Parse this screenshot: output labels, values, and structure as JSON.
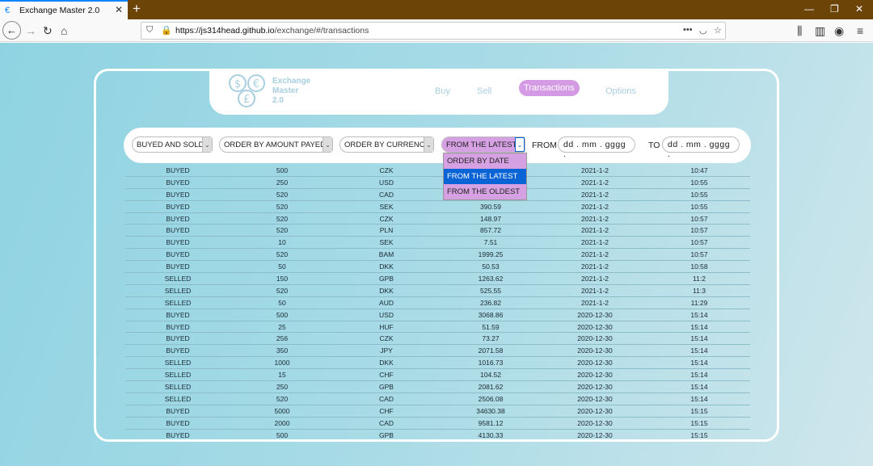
{
  "browser": {
    "tab_title": "Exchange Master 2.0",
    "url_host": "https://js314head.github.io",
    "url_path": "/exchange/#/transactions"
  },
  "header": {
    "brand": [
      "Exchange",
      "Master",
      "2.0"
    ],
    "nav": [
      {
        "label": "Buy"
      },
      {
        "label": "Sell"
      },
      {
        "label": "Transactions"
      },
      {
        "label": "Options"
      }
    ]
  },
  "filters": {
    "type": "BUYED AND SOLD",
    "amount": "ORDER BY AMOUNT PAYED",
    "currency": "ORDER BY CURRENCY",
    "date": "FROM THE LATEST",
    "from_label": "FROM",
    "to_label": "TO",
    "from_placeholder": "dd . mm . gggg .",
    "to_placeholder": "dd . mm . gggg ."
  },
  "dropdown_options": [
    "ORDER BY DATE",
    "FROM THE LATEST",
    "FROM THE OLDEST"
  ],
  "transactions": [
    [
      "BUYED",
      "500",
      "CZK",
      "",
      "2021-1-2",
      "10:47"
    ],
    [
      "BUYED",
      "250",
      "USD",
      "",
      "2021-1-2",
      "10:55"
    ],
    [
      "BUYED",
      "520",
      "CAD",
      "",
      "2021-1-2",
      "10:55"
    ],
    [
      "BUYED",
      "520",
      "SEK",
      "390.59",
      "2021-1-2",
      "10:55"
    ],
    [
      "BUYED",
      "520",
      "CZK",
      "148.97",
      "2021-1-2",
      "10:57"
    ],
    [
      "BUYED",
      "520",
      "PLN",
      "857.72",
      "2021-1-2",
      "10:57"
    ],
    [
      "BUYED",
      "10",
      "SEK",
      "7.51",
      "2021-1-2",
      "10:57"
    ],
    [
      "BUYED",
      "520",
      "BAM",
      "1999.25",
      "2021-1-2",
      "10:57"
    ],
    [
      "BUYED",
      "50",
      "DKK",
      "50.53",
      "2021-1-2",
      "10:58"
    ],
    [
      "SELLED",
      "150",
      "GPB",
      "1263.62",
      "2021-1-2",
      "11:2"
    ],
    [
      "SELLED",
      "520",
      "DKK",
      "525.55",
      "2021-1-2",
      "11:3"
    ],
    [
      "SELLED",
      "50",
      "AUD",
      "236.82",
      "2021-1-2",
      "11:29"
    ],
    [
      "BUYED",
      "500",
      "USD",
      "3068.86",
      "2020-12-30",
      "15:14"
    ],
    [
      "BUYED",
      "25",
      "HUF",
      "51.59",
      "2020-12-30",
      "15:14"
    ],
    [
      "BUYED",
      "256",
      "CZK",
      "73.27",
      "2020-12-30",
      "15:14"
    ],
    [
      "BUYED",
      "350",
      "JPY",
      "2071.58",
      "2020-12-30",
      "15:14"
    ],
    [
      "SELLED",
      "1000",
      "DKK",
      "1016.73",
      "2020-12-30",
      "15:14"
    ],
    [
      "SELLED",
      "15",
      "CHF",
      "104.52",
      "2020-12-30",
      "15:14"
    ],
    [
      "SELLED",
      "250",
      "GPB",
      "2081.62",
      "2020-12-30",
      "15:14"
    ],
    [
      "SELLED",
      "520",
      "CAD",
      "2506.08",
      "2020-12-30",
      "15:14"
    ],
    [
      "BUYED",
      "5000",
      "CHF",
      "34630.38",
      "2020-12-30",
      "15:15"
    ],
    [
      "BUYED",
      "2000",
      "CAD",
      "9581.12",
      "2020-12-30",
      "15:15"
    ],
    [
      "BUYED",
      "500",
      "GPB",
      "4130.33",
      "2020-12-30",
      "15:15"
    ]
  ]
}
